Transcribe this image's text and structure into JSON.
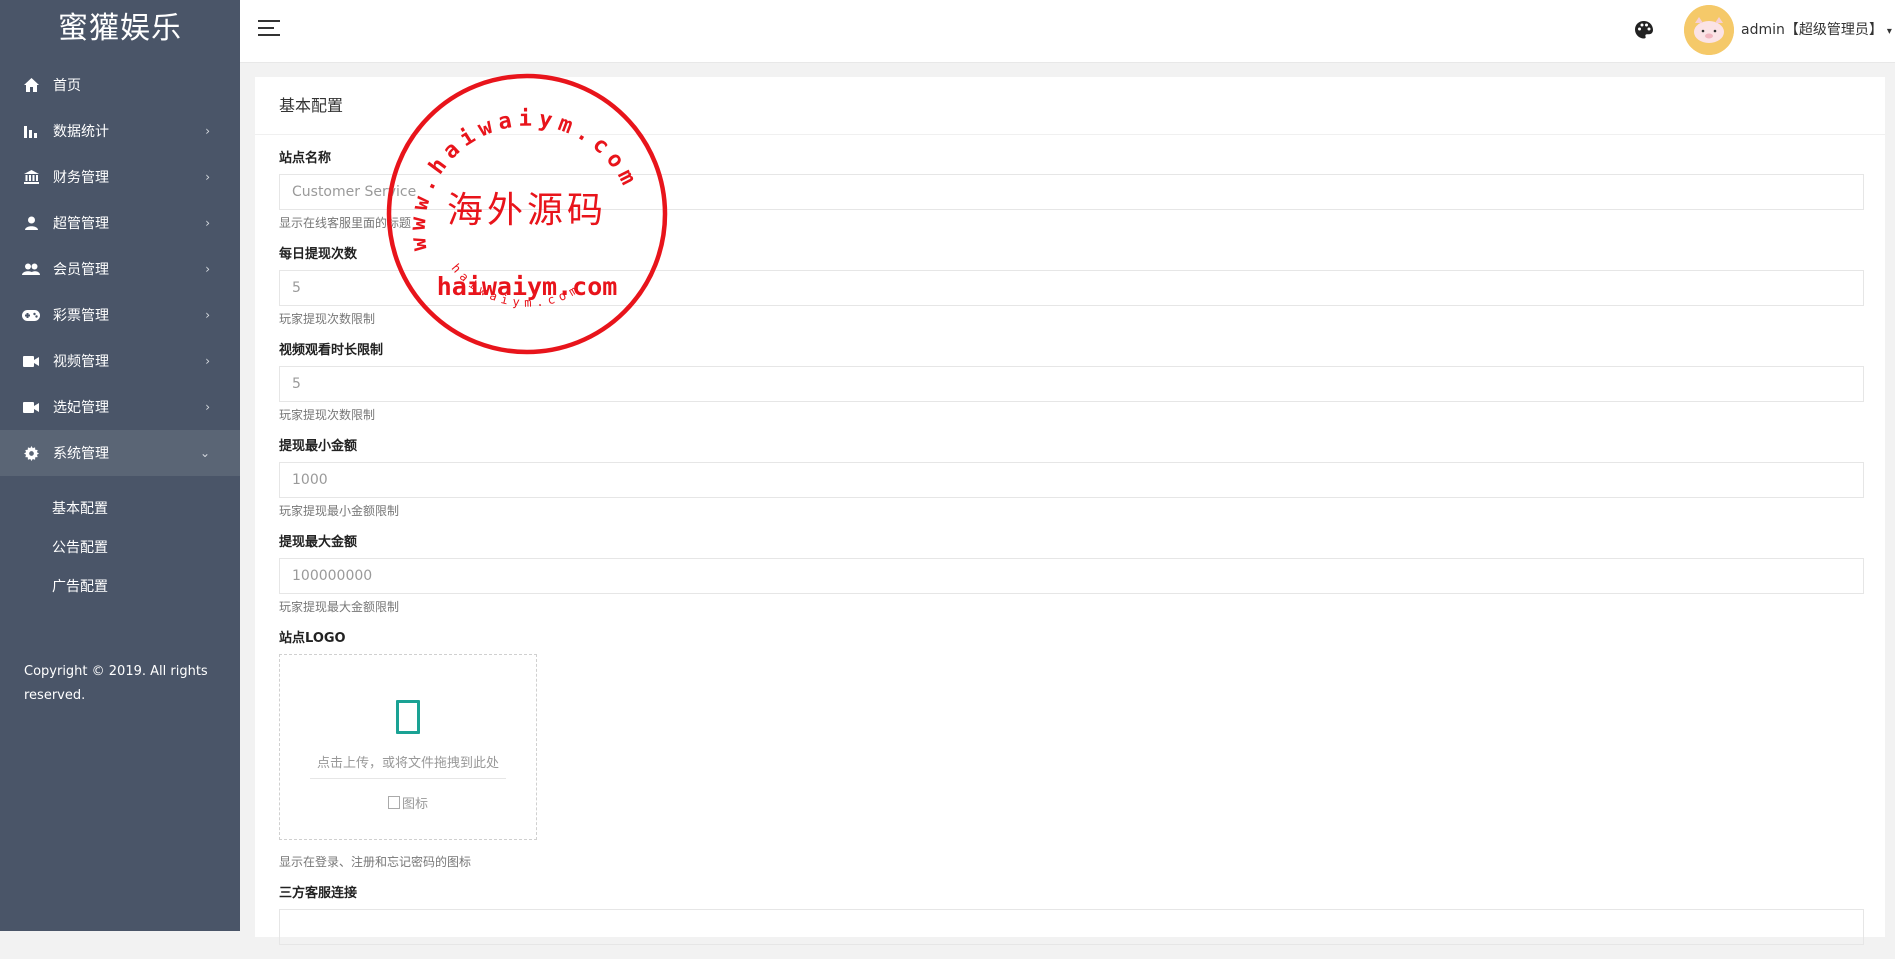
{
  "sidebar": {
    "logo": "蜜獾娱乐",
    "items": [
      {
        "label": "首页",
        "icon": "home-icon"
      },
      {
        "label": "数据统计",
        "icon": "bar-chart-icon"
      },
      {
        "label": "财务管理",
        "icon": "bank-icon"
      },
      {
        "label": "超管管理",
        "icon": "user-icon"
      },
      {
        "label": "会员管理",
        "icon": "users-icon"
      },
      {
        "label": "彩票管理",
        "icon": "gamepad-icon"
      },
      {
        "label": "视频管理",
        "icon": "video-icon"
      },
      {
        "label": "选妃管理",
        "icon": "video-icon"
      },
      {
        "label": "系统管理",
        "icon": "gear-icon"
      }
    ],
    "sub_items": [
      "基本配置",
      "公告配置",
      "广告配置"
    ],
    "copyright": "Copyright © 2019. All rights reserved.",
    "arrow_glyph": "›",
    "arrow_open_glyph": "⌄"
  },
  "header": {
    "user": "admin【超级管理员】",
    "caret": "▾"
  },
  "panel": {
    "title": "基本配置",
    "fields": [
      {
        "label": "站点名称",
        "value": "Customer Service",
        "help": "显示在线客服里面的标题"
      },
      {
        "label": "每日提现次数",
        "value": "5",
        "help": "玩家提现次数限制"
      },
      {
        "label": "视频观看时长限制",
        "value": "5",
        "help": "玩家提现次数限制"
      },
      {
        "label": "提现最小金额",
        "value": "1000",
        "help": "玩家提现最小金额限制"
      },
      {
        "label": "提现最大金额",
        "value": "100000000",
        "help": "玩家提现最大金额限制"
      }
    ],
    "logo_field": {
      "label": "站点LOGO",
      "upload_text": "点击上传，或将文件拖拽到此处",
      "image_alt": "图标",
      "help": "显示在登录、注册和忘记密码的图标"
    },
    "last_field_label": "三方客服连接"
  },
  "watermark": {
    "ring_text": "www.haiwaiym.com",
    "center_text": "海外源码",
    "domain_text": "haiwaiym.com",
    "bottom_text": "haiwaiym.com",
    "color": "#e8141b"
  },
  "colors": {
    "sidebar_bg": "#4a5568",
    "active_bg": "#5a6575",
    "accent": "#1aa294"
  }
}
